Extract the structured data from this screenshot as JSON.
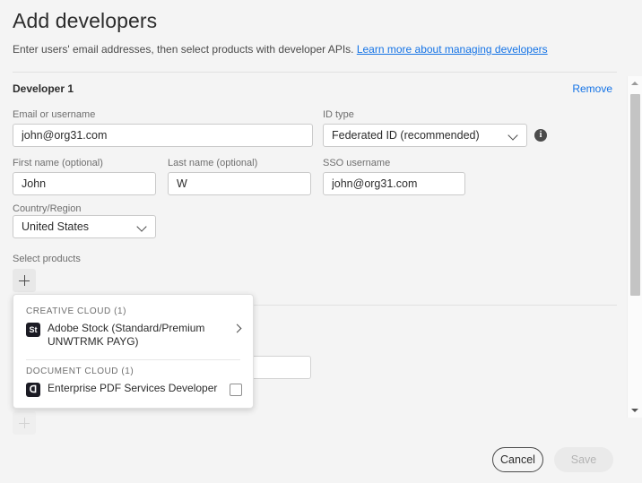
{
  "header": {
    "title": "Add developers",
    "subtitle_text": "Enter users' email addresses, then select products with developer APIs.",
    "subtitle_link": "Learn more about managing developers"
  },
  "developer": {
    "section_label": "Developer 1",
    "remove_label": "Remove",
    "fields": {
      "email": {
        "label": "Email or username",
        "value": "john@org31.com"
      },
      "id_type": {
        "label": "ID type",
        "value": "Federated ID (recommended)"
      },
      "first_name": {
        "label": "First name (optional)",
        "value": "John"
      },
      "last_name": {
        "label": "Last name (optional)",
        "value": "W"
      },
      "sso_username": {
        "label": "SSO username",
        "value": "john@org31.com"
      },
      "country": {
        "label": "Country/Region",
        "value": "United States"
      }
    },
    "select_products_label": "Select products",
    "info_icon_glyph": "i",
    "add_product_glyph": "+"
  },
  "product_popup": {
    "groups": [
      {
        "heading": "CREATIVE CLOUD (1)",
        "items": [
          {
            "icon": "adobe-stock-icon",
            "icon_glyph": "St",
            "label": "Adobe Stock (Standard/Premium UNWTRMK PAYG)",
            "trailing": "chevron-right"
          }
        ]
      },
      {
        "heading": "DOCUMENT CLOUD (1)",
        "items": [
          {
            "icon": "acrobat-pdf-icon",
            "icon_glyph": "ᗡ",
            "label": "Enterprise PDF Services Developer",
            "trailing": "checkbox"
          }
        ]
      }
    ]
  },
  "footer": {
    "cancel_label": "Cancel",
    "save_label": "Save",
    "save_disabled": true
  },
  "colors": {
    "background": "#f4f4f4",
    "link": "#1473e6",
    "text": "#2c2c2c",
    "muted_text": "#6e6e6e",
    "border": "#cacaca",
    "scrollbar_thumb": "#c4c4c4"
  }
}
